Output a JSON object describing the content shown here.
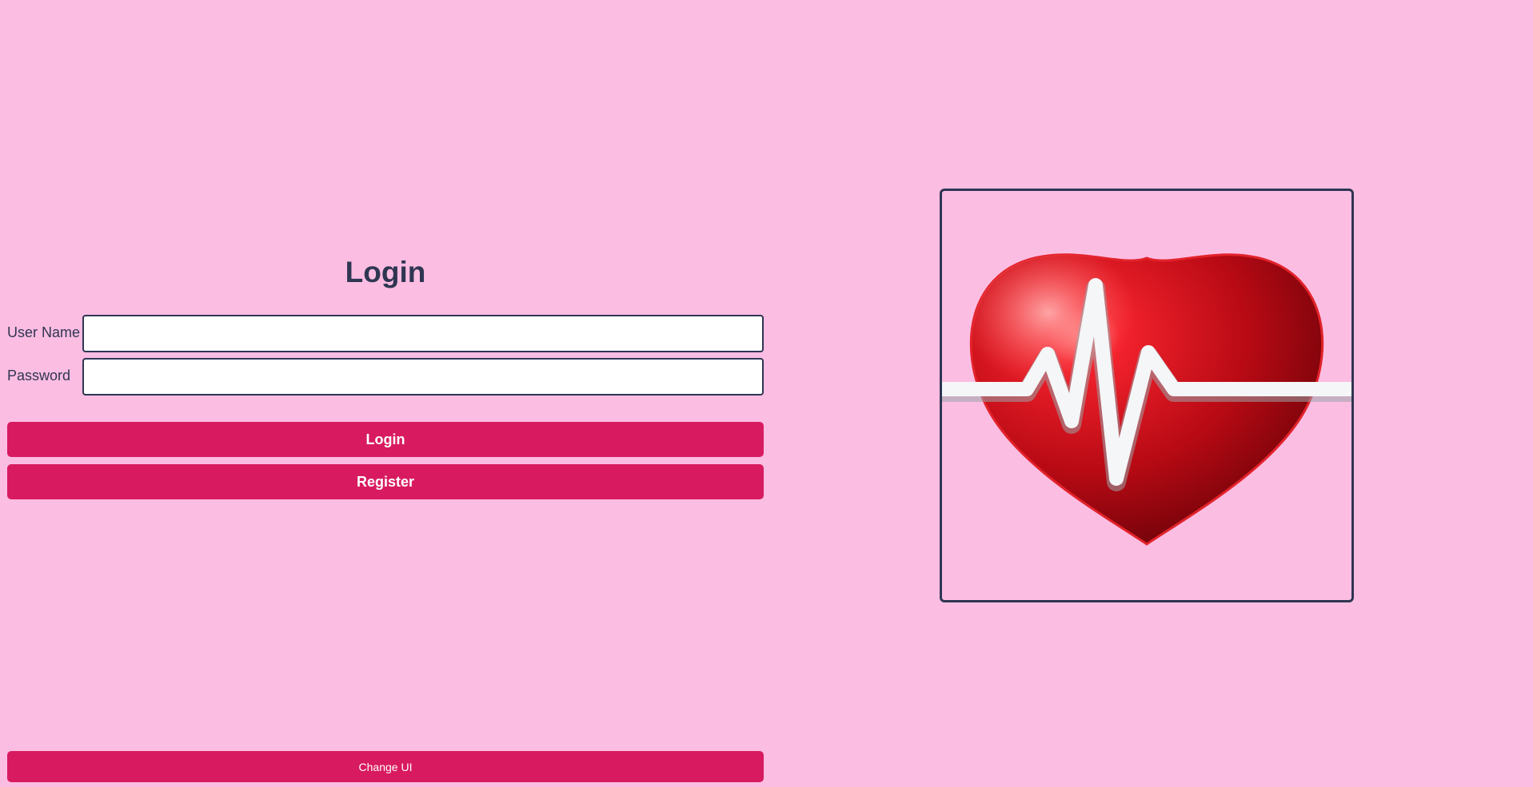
{
  "login_form": {
    "title": "Login",
    "username_label": "User Name",
    "username_value": "",
    "password_label": "Password",
    "password_value": "",
    "login_button_label": "Login",
    "register_button_label": "Register"
  },
  "footer": {
    "change_ui_button_label": "Change UI"
  },
  "illustration": {
    "icon": "heart-pulse-icon"
  },
  "colors": {
    "background": "#fcbde3",
    "accent": "#d81b60",
    "text": "#2f3652",
    "heart": "#c4101c"
  }
}
